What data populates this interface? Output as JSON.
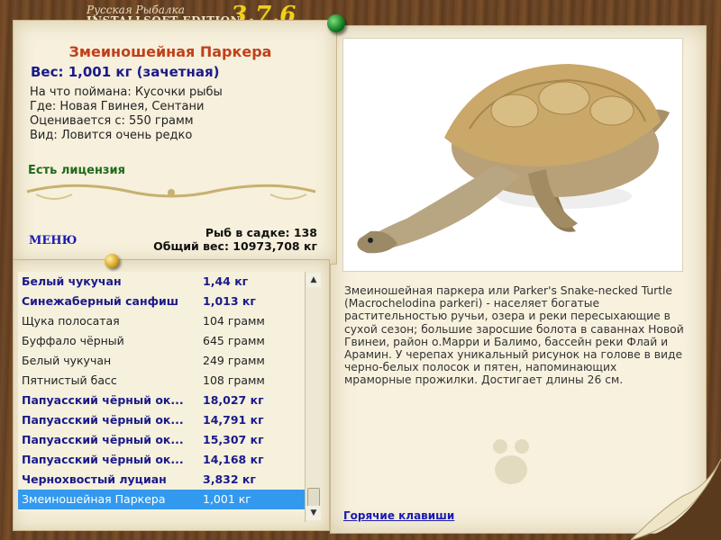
{
  "window": {
    "title_small": "Русская Рыбалка",
    "title_big": "INSTALLSOFT EDITION",
    "version": "3.7.6"
  },
  "fish": {
    "name": "Змеиношейная Паркера",
    "weight": "Вес: 1,001 кг (зачетная)",
    "caught_on": "На что поймана: Кусочки рыбы",
    "where": "Где: Новая Гвинея, Сентани",
    "valued_from": "Оценивается с: 550 грамм",
    "kind": "Вид: Ловится очень редко",
    "license": "Есть лицензия"
  },
  "menu": {
    "label": "МЕНЮ"
  },
  "cage": {
    "fish_count": "Рыб в садке: 138",
    "total_weight": "Общий вес: 10973,708 кг"
  },
  "list": {
    "rows": [
      {
        "name": "Белый чукучан",
        "weight": "1,44 кг",
        "style": "big"
      },
      {
        "name": "Синежаберный санфиш",
        "weight": "1,013 кг",
        "style": "big"
      },
      {
        "name": "Щука полосатая",
        "weight": "104 грамм",
        "style": "norm"
      },
      {
        "name": "Буффало чёрный",
        "weight": "645 грамм",
        "style": "norm"
      },
      {
        "name": "Белый чукучан",
        "weight": "249 грамм",
        "style": "norm"
      },
      {
        "name": "Пятнистый басс",
        "weight": "108 грамм",
        "style": "norm"
      },
      {
        "name": "Папуасский чёрный ок...",
        "weight": "18,027 кг",
        "style": "big"
      },
      {
        "name": "Папуасский чёрный ок...",
        "weight": "14,791 кг",
        "style": "big"
      },
      {
        "name": "Папуасский чёрный ок...",
        "weight": "15,307 кг",
        "style": "big"
      },
      {
        "name": "Папуасский чёрный ок...",
        "weight": "14,168 кг",
        "style": "big"
      },
      {
        "name": "Чернохвостый луциан",
        "weight": "3,832 кг",
        "style": "big"
      },
      {
        "name": "Змеиношейная Паркера",
        "weight": "1,001 кг",
        "style": "sel"
      }
    ]
  },
  "description": "Змеиношейная паркера или Parker's Snake-necked Turtle (Macrochelodina parkeri) - населяет богатые растительностью ручьи, озера и реки пересыхающие в сухой сезон; большие заросшие болота в саваннах Новой Гвинеи, район о.Марри и Балимо, бассейн реки Флай и Арамин. У черепах уникальный рисунок на голове в виде черно-белых полосок и пятен, напоминающих мраморные прожилки. Достигает длины 26 см.",
  "hotkeys": {
    "label": "Горячие клавиши"
  },
  "colors": {
    "accent_title": "#c0401a",
    "accent_weight": "#1a1a8a",
    "license_green": "#1f6a1a",
    "selection": "#3399ee",
    "link": "#1a1ab0",
    "version_gold": "#f0d020"
  }
}
